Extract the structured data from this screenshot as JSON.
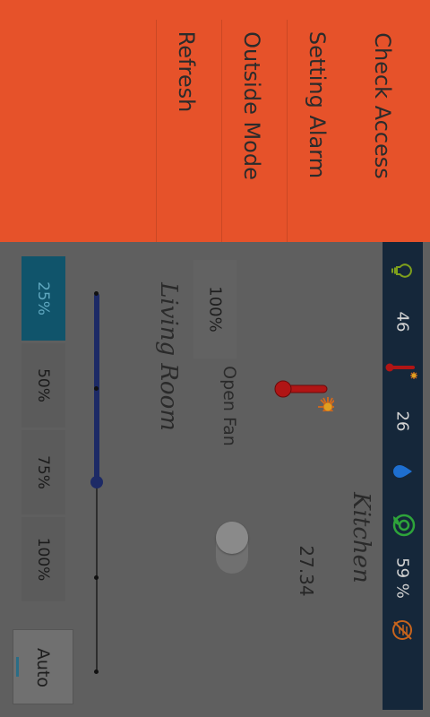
{
  "menu": {
    "items": [
      {
        "label": "Check Access"
      },
      {
        "label": "Setting Alarm"
      },
      {
        "label": "Outside Mode"
      },
      {
        "label": "Refresh"
      }
    ]
  },
  "status_bar": {
    "light_value": "46",
    "temperature_value": "26",
    "humidity_value": "59 %",
    "icons": [
      "bulb-icon",
      "thermometer-icon",
      "water-drop-icon",
      "plant-icon",
      "no-motion-icon"
    ],
    "colors": {
      "background": "#15273a",
      "bulb": "#7fa01c",
      "drop": "#1e6fd0",
      "plant": "#2ea43a",
      "motion": "#c8641c"
    }
  },
  "kitchen": {
    "title": "Kitchen",
    "temperature": "27.34"
  },
  "living_room": {
    "title": "Living Room",
    "fan_label": "Open Fan",
    "fan_speed": "100%",
    "fan_on": false,
    "slider_fraction": 0.5,
    "speed_options": [
      "25%",
      "50%",
      "75%",
      "100%"
    ],
    "selected_option": "25%",
    "auto_label": "Auto"
  },
  "colors": {
    "menu_background": "#e6522a",
    "overlay_background": "#5f5f5f",
    "selected_segment": "#10546b",
    "slider": "#1d2a66"
  }
}
